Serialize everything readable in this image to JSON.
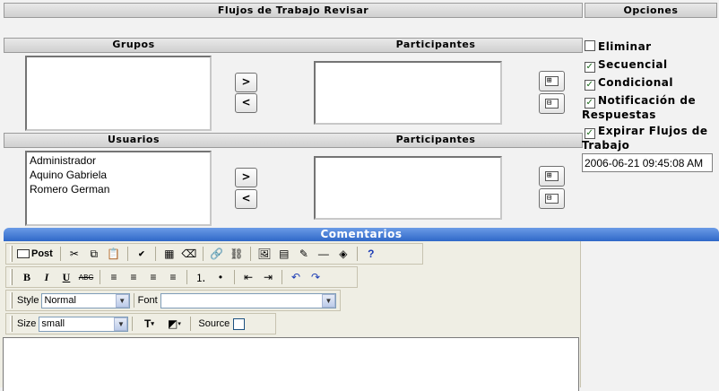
{
  "header": {
    "title": "Flujos de Trabajo Revisar",
    "options_title": "Opciones"
  },
  "groups_section": {
    "groups_label": "Grupos",
    "participants_label": "Participantes",
    "groups_items": [],
    "participants_items": [],
    "add_icon": "chevron-right-icon",
    "remove_icon": "chevron-left-icon",
    "add_label": ">",
    "remove_label": "<"
  },
  "users_section": {
    "users_label": "Usuarios",
    "participants_label": "Participantes",
    "users_items": [
      "Administrador",
      "Aquino Gabriela",
      "Romero German"
    ],
    "participants_items": [],
    "add_label": ">",
    "remove_label": "<"
  },
  "options": {
    "eliminar": {
      "label": "Eliminar",
      "checked": false
    },
    "secuencial": {
      "label": "Secuencial",
      "checked": true
    },
    "condicional": {
      "label": "Condicional",
      "checked": true
    },
    "notificacion": {
      "label": "Notificación de Respuestas",
      "checked": true
    },
    "expirar": {
      "label": "Expirar Flujos de Trabajo",
      "checked": true
    },
    "expire_date": "2006-06-21 09:45:08 AM"
  },
  "comments": {
    "title": "Comentarios",
    "post_label": "Post",
    "style_label": "Style",
    "style_value": "Normal",
    "font_label": "Font",
    "font_value": "",
    "size_label": "Size",
    "size_value": "small",
    "source_label": "Source",
    "bold": "B",
    "italic": "I",
    "underline": "U",
    "strike": "ABC",
    "body_text": ""
  },
  "colors": {
    "accent_bar": "#3d78d8",
    "check_color": "#1a6a1a"
  }
}
